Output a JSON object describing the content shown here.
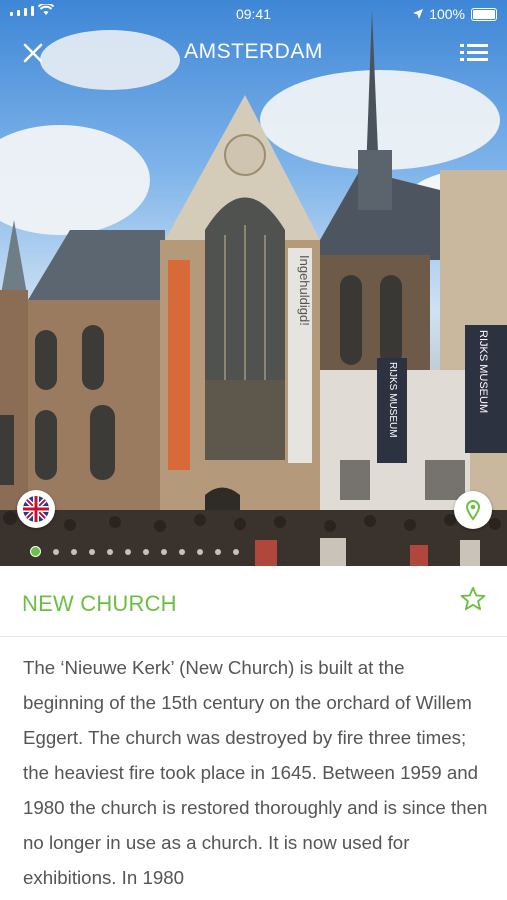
{
  "status_bar": {
    "time": "09:41",
    "battery": "100%"
  },
  "nav": {
    "title": "AMSTERDAM"
  },
  "hero": {
    "banner_texts": [
      "Ingehuldigd!",
      "RIJKS MUSEUM",
      "RIJKS MUSEUM"
    ],
    "page_dots": 12,
    "active_dot": 1
  },
  "place": {
    "title": "NEW CHURCH",
    "description": "The ‘Nieuwe Kerk’ (New Church) is built at the beginning of the 15th century on the orchard of Willem Eggert. The church was destroyed by fire three times; the heaviest fire took place in 1645. Between 1959 and 1980 the church is restored thoroughly and is since then no longer in use as a church. It is now used for exhibitions. In 1980"
  },
  "icons": {
    "close": "close-icon",
    "menu": "list-menu-icon",
    "flag": "uk-flag-icon",
    "map": "map-pin-icon",
    "star": "star-outline-icon",
    "location": "location-arrow-icon"
  },
  "colors": {
    "accent": "#6cbf45",
    "text": "#555555"
  }
}
